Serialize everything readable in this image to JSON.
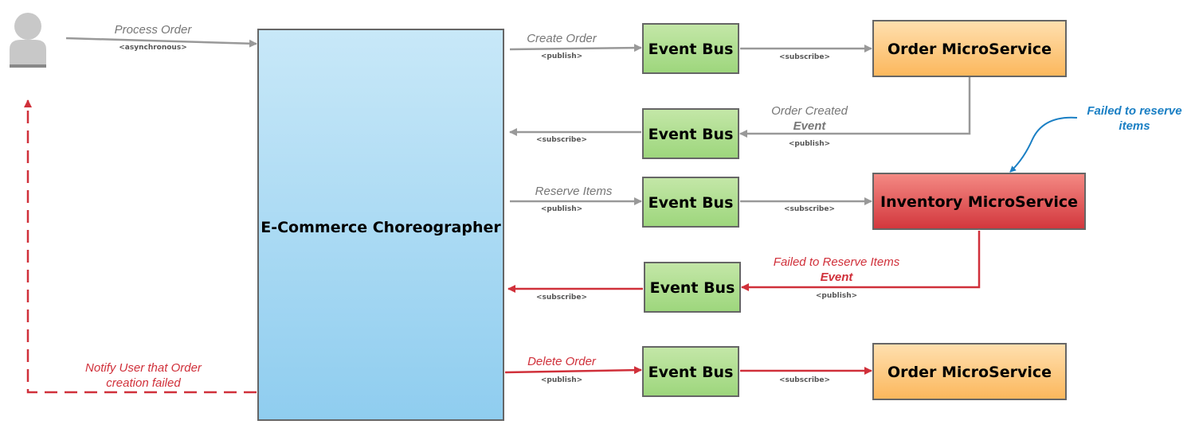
{
  "choreographer": {
    "label": "E-Commerce Choreographer"
  },
  "event_bus_label": "Event Bus",
  "buses": [
    "Event Bus",
    "Event Bus",
    "Event Bus",
    "Event Bus",
    "Event Bus"
  ],
  "services": {
    "order_top": "Order MicroService",
    "inventory": "Inventory MicroService",
    "order_bottom": "Order MicroService"
  },
  "flows": {
    "process_order": {
      "label": "Process Order",
      "tag": "<asynchronous>"
    },
    "create_order": {
      "label": "Create Order",
      "tag": "<publish>"
    },
    "create_subscribe": {
      "tag": "<subscribe>"
    },
    "order_created": {
      "label": "Order Created",
      "event": "Event",
      "tag": "<publish>"
    },
    "order_created_subscribe": {
      "tag": "<subscribe>"
    },
    "reserve_items": {
      "label": "Reserve Items",
      "tag": "<publish>"
    },
    "reserve_subscribe": {
      "tag": "<subscribe>"
    },
    "failed_reserve": {
      "label": "Failed to Reserve Items",
      "event": "Event",
      "tag": "<publish>"
    },
    "failed_subscribe": {
      "tag": "<subscribe>"
    },
    "delete_order": {
      "label": "Delete Order",
      "tag": "<publish>"
    },
    "delete_subscribe": {
      "tag": "<subscribe>"
    },
    "notify_user": {
      "line1": "Notify User that Order",
      "line2": "creation failed"
    }
  },
  "annotation": {
    "line1": "Failed to reserve",
    "line2": "items"
  },
  "colors": {
    "gray_arrow": "#999999",
    "red_arrow": "#d0303a",
    "blue_note": "#1a7fc4"
  }
}
